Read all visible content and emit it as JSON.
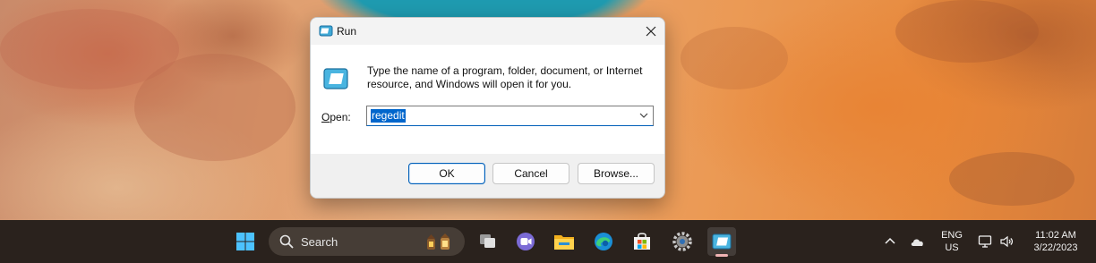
{
  "dialog": {
    "title": "Run",
    "description": "Type the name of a program, folder, document, or Internet resource, and Windows will open it for you.",
    "open_label_underlined": "O",
    "open_label_rest": "pen:",
    "input_value": "regedit",
    "buttons": {
      "ok": "OK",
      "cancel": "Cancel",
      "browse": "Browse..."
    }
  },
  "taskbar": {
    "search_placeholder": "Search",
    "apps": [
      "start-icon",
      "task-view-icon",
      "teams-chat-icon",
      "file-explorer-icon",
      "edge-icon",
      "store-icon",
      "settings-icon",
      "run-icon"
    ],
    "language": "ENG",
    "region": "US",
    "time": "11:02 AM",
    "date": "3/22/2023"
  },
  "colors": {
    "accent": "#005fb8",
    "taskbar": "#2a221d",
    "selection": "#0066cc"
  }
}
